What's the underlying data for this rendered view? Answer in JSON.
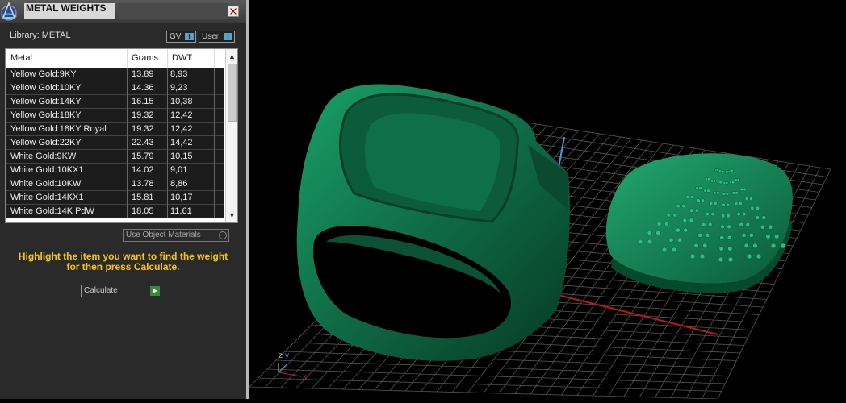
{
  "panel": {
    "title": "METAL WEIGHTS",
    "library_label": "Library: METAL",
    "toggle_gv": "GV",
    "toggle_user": "User",
    "toggle_marker": "I",
    "columns": [
      "Metal",
      "Grams",
      "DWT"
    ],
    "rows": [
      {
        "metal": "Yellow Gold:9KY",
        "grams": "13.89",
        "dwt": "8,93"
      },
      {
        "metal": "Yellow Gold:10KY",
        "grams": "14.36",
        "dwt": "9,23"
      },
      {
        "metal": "Yellow Gold:14KY",
        "grams": "16.15",
        "dwt": "10,38"
      },
      {
        "metal": "Yellow Gold:18KY",
        "grams": "19.32",
        "dwt": "12,42"
      },
      {
        "metal": "Yellow Gold:18KY Royal",
        "grams": "19.32",
        "dwt": "12,42"
      },
      {
        "metal": "Yellow Gold:22KY",
        "grams": "22.43",
        "dwt": "14,42"
      },
      {
        "metal": "White Gold:9KW",
        "grams": "15.79",
        "dwt": "10,15"
      },
      {
        "metal": "White Gold:10KX1",
        "grams": "14.02",
        "dwt": "9,01"
      },
      {
        "metal": "White Gold:10KW",
        "grams": "13.78",
        "dwt": "8,86"
      },
      {
        "metal": "White Gold:14KX1",
        "grams": "15.81",
        "dwt": "10,17"
      },
      {
        "metal": "White Gold:14K PdW",
        "grams": "18.05",
        "dwt": "11,61"
      }
    ],
    "use_object_materials": "Use Object Materials",
    "instructions_line1": "Highlight the item you want to find the weight",
    "instructions_line2": "for then press Calculate.",
    "calculate_label": "Calculate"
  },
  "viewport": {
    "axis_x": "x",
    "axis_y": "y",
    "axis_z": "z",
    "model_color": "#0f6b45"
  },
  "icons": [
    "app-logo-icon",
    "close-icon",
    "scroll-up-icon",
    "scroll-down-icon",
    "play-icon"
  ]
}
